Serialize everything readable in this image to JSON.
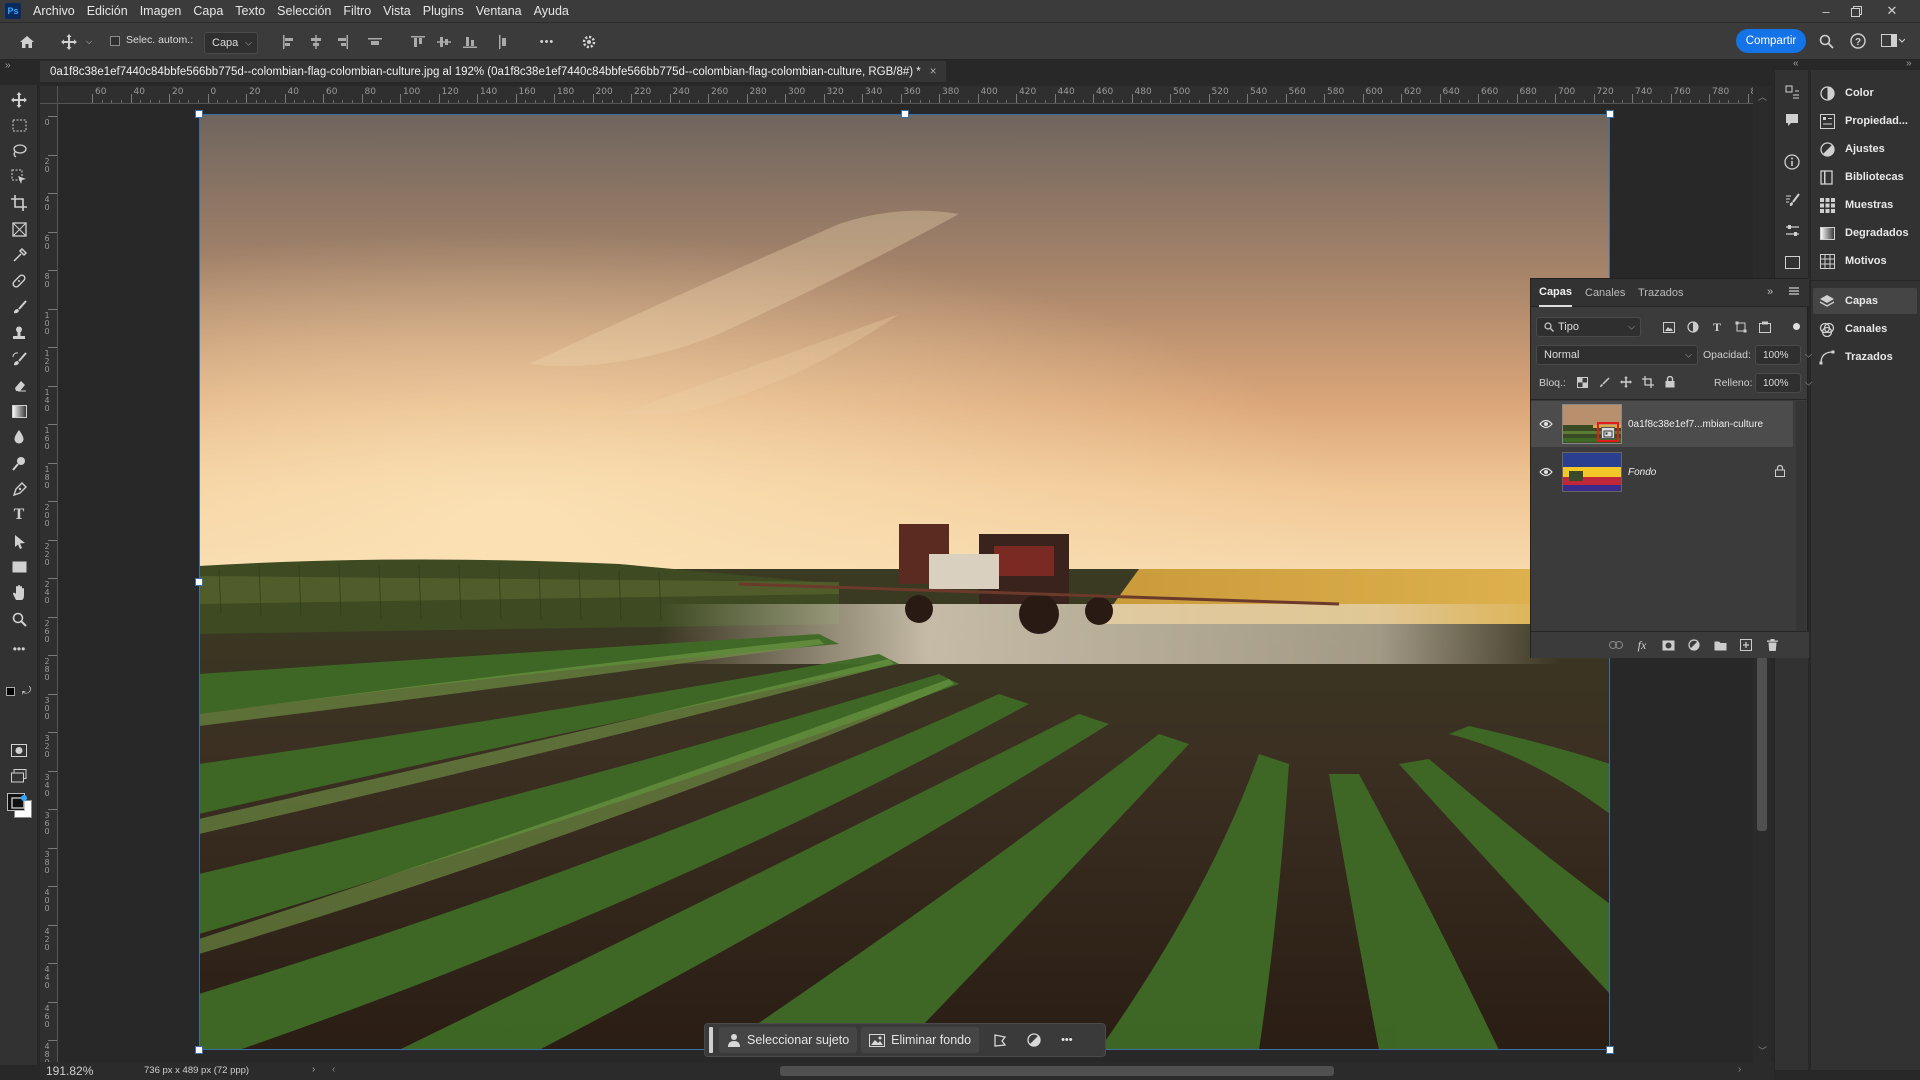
{
  "app": {
    "logo_text": "Ps",
    "menu": [
      "Archivo",
      "Edición",
      "Imagen",
      "Capa",
      "Texto",
      "Selección",
      "Filtro",
      "Vista",
      "Plugins",
      "Ventana",
      "Ayuda"
    ]
  },
  "options_bar": {
    "auto_select_label": "Selec. autom.:",
    "auto_select_checked": false,
    "auto_select_target": "Capa",
    "share_label": "Compartir",
    "more_label": "•••"
  },
  "document": {
    "tab_title": "0a1f8c38e1ef7440c84bbfe566bb775d--colombian-flag-colombian-culture.jpg al 192% (0a1f8c38e1ef7440c84bbfe566bb775d--colombian-flag-colombian-culture, RGB/8#) *",
    "close_label": "×"
  },
  "ruler": {
    "h_labels": [
      "60",
      "40",
      "20",
      "0",
      "20",
      "40",
      "60",
      "80",
      "100",
      "120",
      "140",
      "160",
      "180",
      "200",
      "220",
      "240",
      "260",
      "280",
      "300",
      "320",
      "340",
      "360",
      "380",
      "400",
      "420",
      "440",
      "460",
      "480",
      "500",
      "520",
      "540",
      "560",
      "580",
      "600",
      "620",
      "640",
      "660",
      "680",
      "700",
      "720",
      "740",
      "760",
      "780",
      "800"
    ],
    "v_labels": [
      "0",
      "2 0",
      "4 0",
      "6 0",
      "8 0",
      "1 0 0",
      "1 2 0",
      "1 4 0",
      "1 6 0",
      "1 8 0",
      "2 0 0",
      "2 2 0",
      "2 4 0",
      "2 6 0",
      "2 8 0",
      "3 0 0",
      "3 2 0",
      "3 4 0",
      "3 6 0",
      "3 8 0",
      "4 0 0",
      "4 2 0",
      "4 4 0",
      "4 6 0",
      "4 8 0"
    ]
  },
  "right_dock": {
    "panels": [
      {
        "icon": "color-icon",
        "label": "Color"
      },
      {
        "icon": "properties-icon",
        "label": "Propiedad..."
      },
      {
        "icon": "adjustments-icon",
        "label": "Ajustes"
      },
      {
        "icon": "libraries-icon",
        "label": "Bibliotecas"
      },
      {
        "icon": "swatches-icon",
        "label": "Muestras"
      },
      {
        "icon": "gradients-icon",
        "label": "Degradados"
      },
      {
        "icon": "patterns-icon",
        "label": "Motivos"
      },
      {
        "icon": "layers-icon",
        "label": "Capas"
      },
      {
        "icon": "channels-icon",
        "label": "Canales"
      },
      {
        "icon": "paths-icon",
        "label": "Trazados"
      }
    ]
  },
  "layers_panel": {
    "tabs": [
      "Capas",
      "Canales",
      "Trazados"
    ],
    "active_tab": "Capas",
    "filter_label": "Tipo",
    "blend_mode": "Normal",
    "opacity_label": "Opacidad:",
    "opacity_value": "100%",
    "lock_label": "Bloq.:",
    "fill_label": "Relleno:",
    "fill_value": "100%",
    "layers": [
      {
        "name": "0a1f8c38e1ef7...mbian-culture",
        "visible": true,
        "smart_object": true,
        "selected": true
      },
      {
        "name": "Fondo",
        "visible": true,
        "locked": true,
        "selected": false
      }
    ]
  },
  "context_bar": {
    "select_subject": "Seleccionar sujeto",
    "remove_background": "Eliminar fondo",
    "more_label": "•••"
  },
  "status_bar": {
    "zoom": "191.82%",
    "doc_info": "736 px x 489 px (72 ppp)"
  },
  "colors": {
    "accent": "#1473e6",
    "highlight_box": "#e21c1c",
    "selection_handle_border": "#3a6ea5"
  }
}
